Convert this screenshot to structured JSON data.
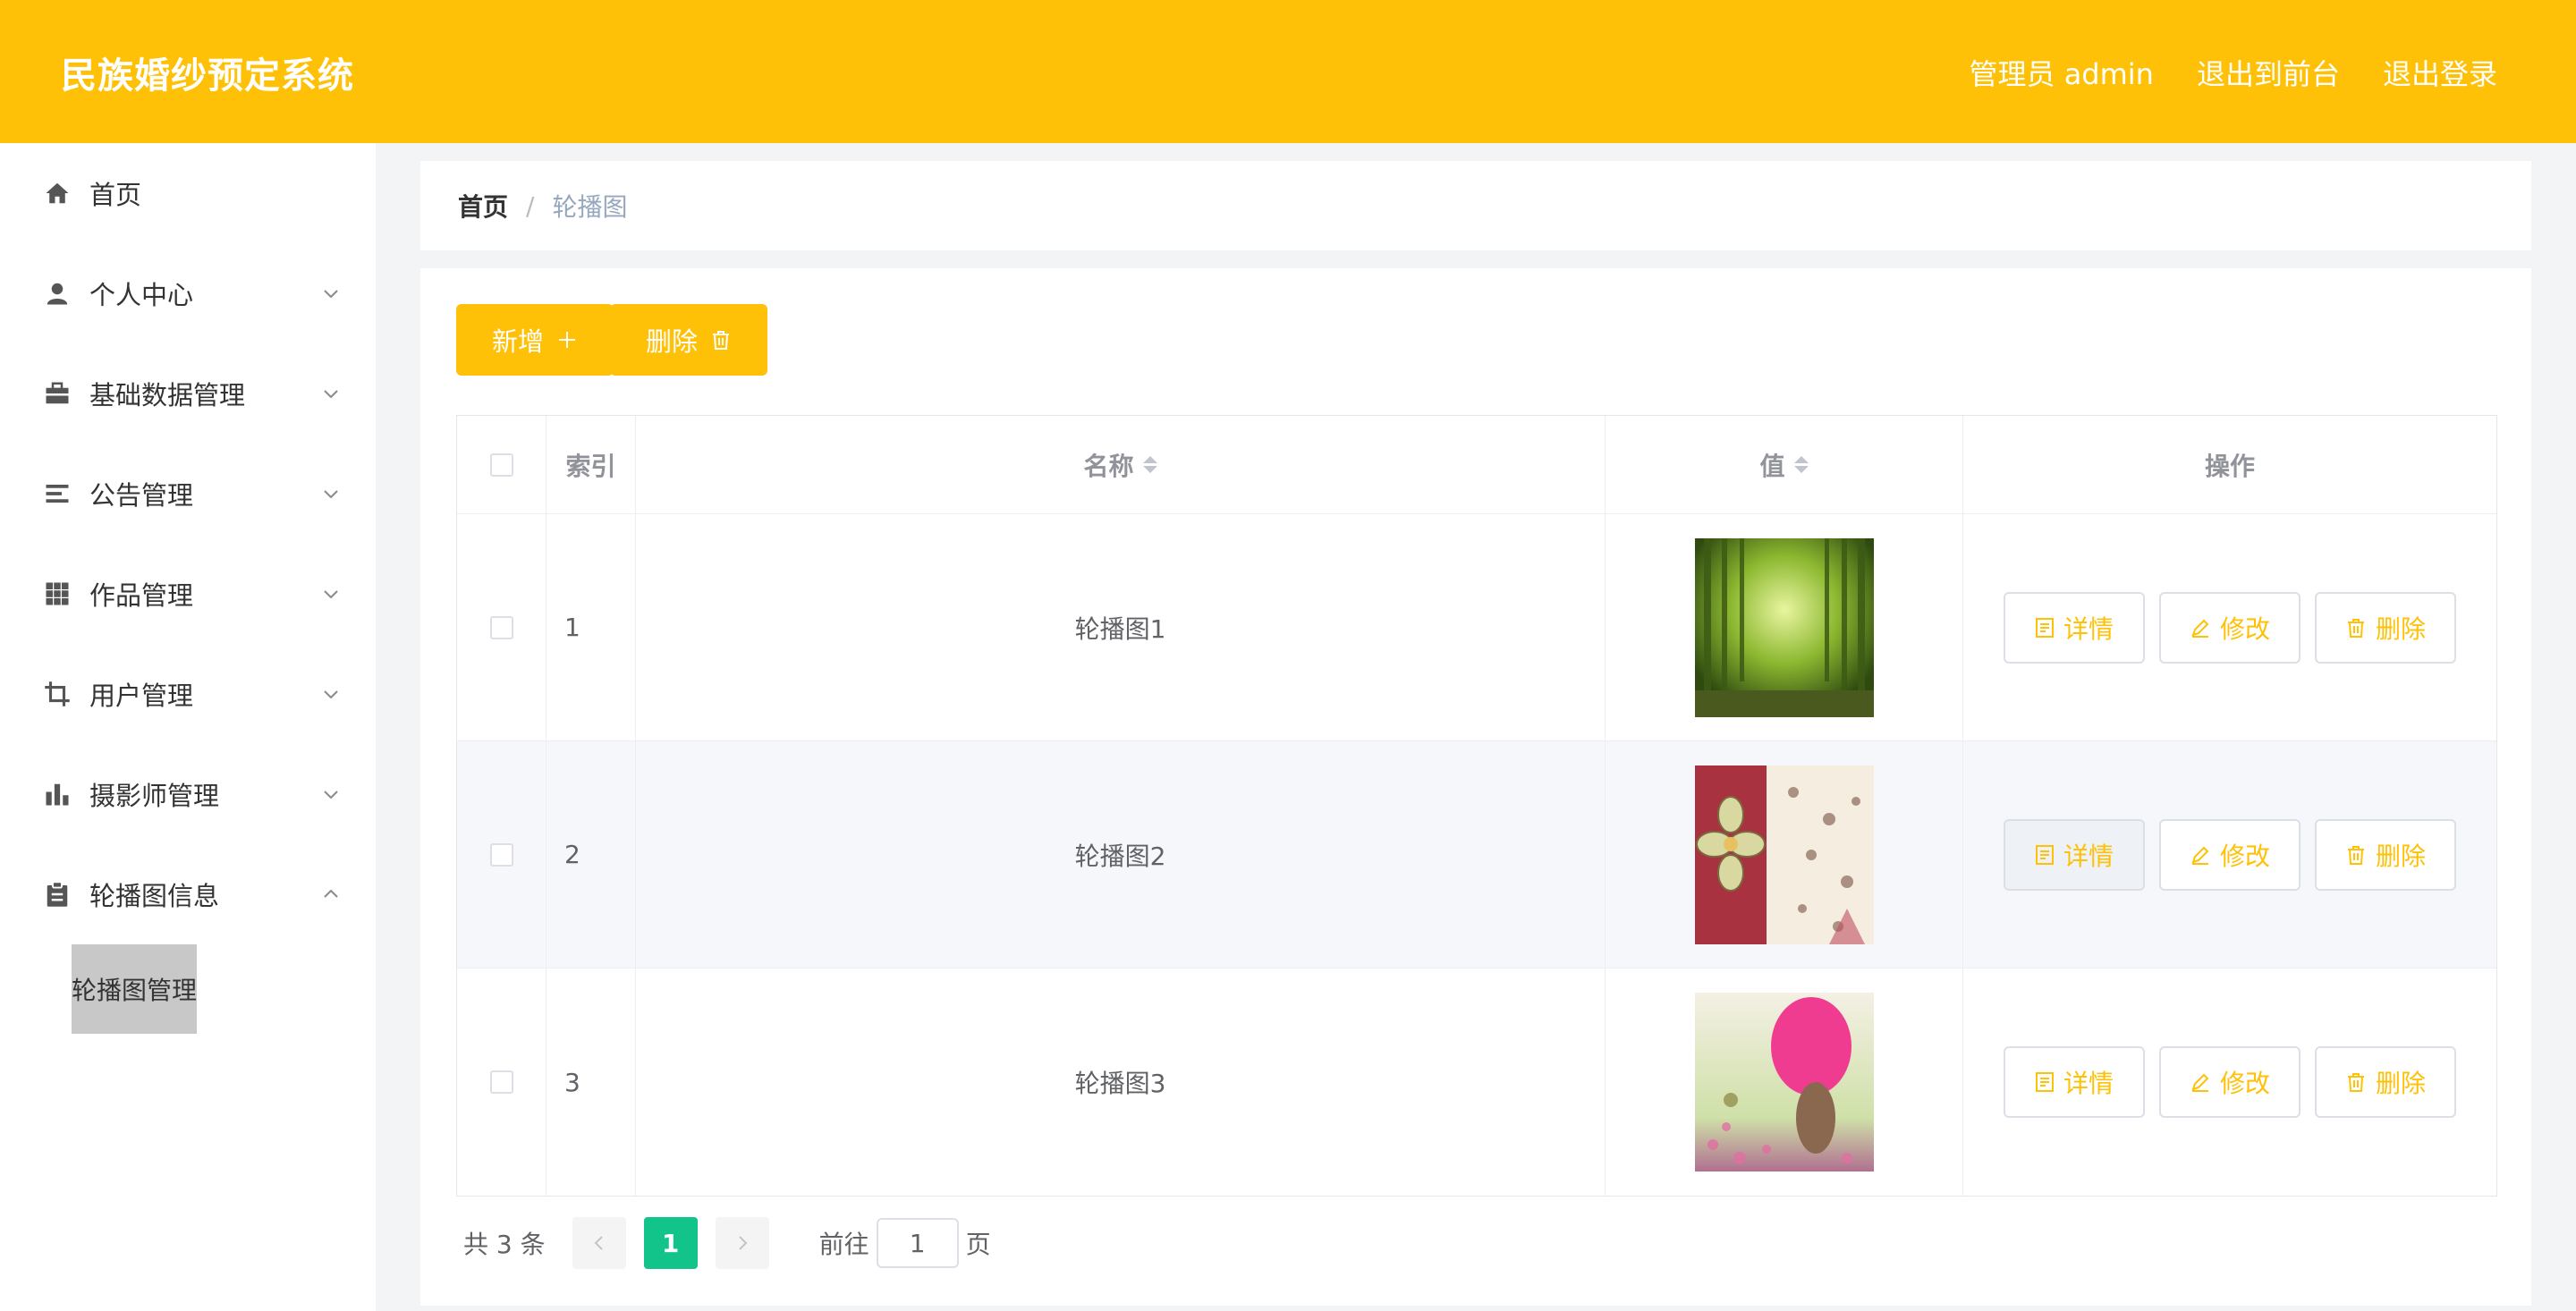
{
  "header": {
    "app_title": "民族婚纱预定系统",
    "admin_label": "管理员 admin",
    "exit_front_label": "退出到前台",
    "logout_label": "退出登录",
    "bg_color": "#ffc107"
  },
  "sidebar": {
    "items": [
      {
        "label": "首页",
        "icon": "home-icon"
      },
      {
        "label": "个人中心",
        "icon": "user-icon"
      },
      {
        "label": "基础数据管理",
        "icon": "briefcase-icon"
      },
      {
        "label": "公告管理",
        "icon": "list-icon"
      },
      {
        "label": "作品管理",
        "icon": "grid-icon"
      },
      {
        "label": "用户管理",
        "icon": "crop-icon"
      },
      {
        "label": "摄影师管理",
        "icon": "bar-chart-icon"
      },
      {
        "label": "轮播图信息",
        "icon": "clipboard-icon"
      }
    ],
    "active_sub_item": "轮播图管理"
  },
  "breadcrumb": {
    "home": "首页",
    "separator": "/",
    "current": "轮播图"
  },
  "toolbar": {
    "add_label": "新增",
    "delete_label": "删除"
  },
  "table": {
    "headers": {
      "index": "索引",
      "name": "名称",
      "value": "值",
      "actions": "操作"
    },
    "rows": [
      {
        "index": "1",
        "name": "轮播图1",
        "image": "forest-image"
      },
      {
        "index": "2",
        "name": "轮播图2",
        "image": "flower-hearts-image"
      },
      {
        "index": "3",
        "name": "轮播图3",
        "image": "pink-umbrella-image"
      }
    ],
    "action_labels": {
      "detail": "详情",
      "edit": "修改",
      "delete": "删除"
    }
  },
  "pagination": {
    "total_text": "共 3 条",
    "current_page": "1",
    "goto_label": "前往",
    "goto_value": "1",
    "page_suffix": "页"
  }
}
